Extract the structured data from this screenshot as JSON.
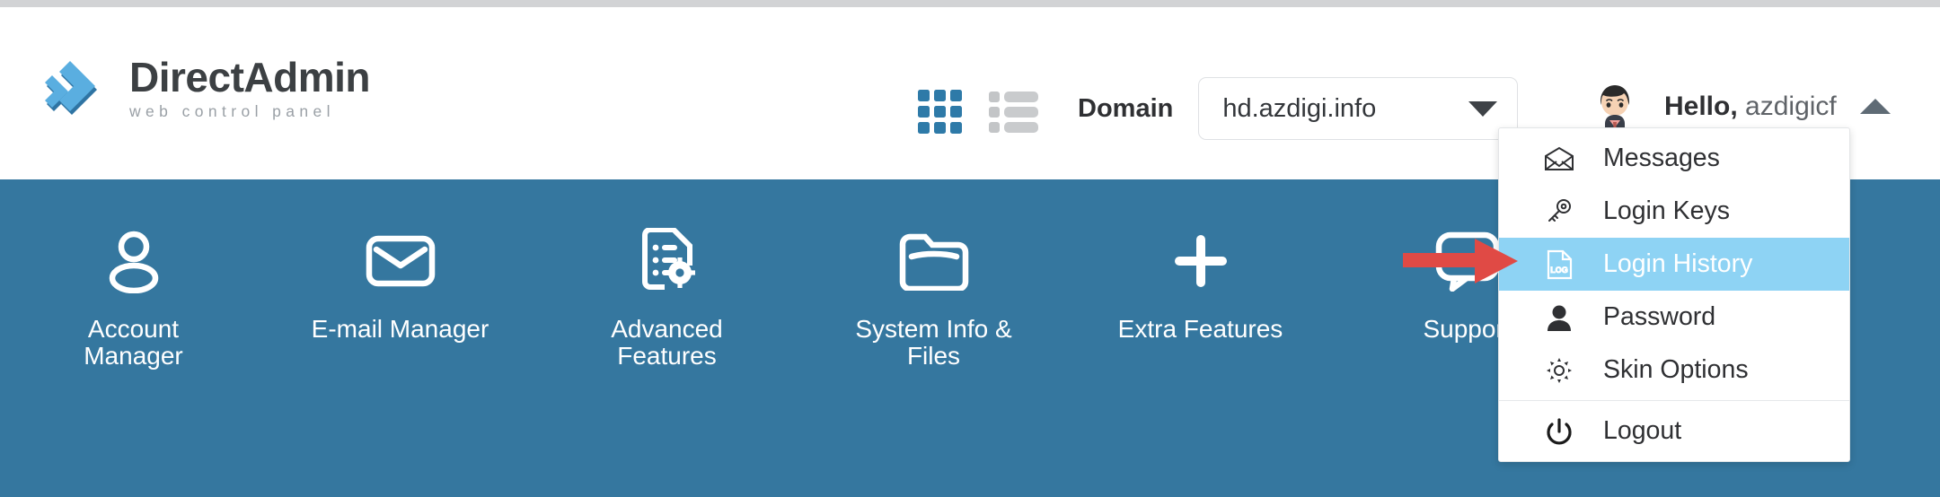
{
  "brand": {
    "name_part1": "Direct",
    "name_part2": "Admin",
    "tagline": "web control panel",
    "logo_icon": "double-chevron-logo",
    "logo_color": "#5aaee0",
    "logo_shadow_color": "#2f74a3"
  },
  "header": {
    "view_grid_icon": "grid-view-icon",
    "view_list_icon": "list-view-icon",
    "grid_active_color": "#2e7aa8",
    "list_inactive_color": "#c6c8ca",
    "domain_label": "Domain",
    "domain_value": "hd.azdigi.info",
    "domain_caret_icon": "chevron-down-icon",
    "avatar_icon": "user-avatar",
    "greeting_prefix": "Hello,",
    "username": "azdigicf",
    "user_caret_icon": "chevron-up-icon"
  },
  "navbar": {
    "background_color": "#35779f",
    "items": [
      {
        "label": "Account Manager",
        "icon": "person-icon"
      },
      {
        "label": "E-mail Manager",
        "icon": "envelope-icon"
      },
      {
        "label": "Advanced Features",
        "icon": "document-gear-icon"
      },
      {
        "label": "System Info & Files",
        "icon": "folder-icon"
      },
      {
        "label": "Extra Features",
        "icon": "plus-icon"
      },
      {
        "label": "Support",
        "icon": "chat-bubble-icon"
      }
    ]
  },
  "user_menu": {
    "highlight_color": "#8ed3f4",
    "items": [
      {
        "label": "Messages",
        "icon": "envelope-open-icon",
        "active": false
      },
      {
        "label": "Login Keys",
        "icon": "key-icon",
        "active": false
      },
      {
        "label": "Login History",
        "icon": "log-document-icon",
        "active": true
      },
      {
        "label": "Password",
        "icon": "person-filled-icon",
        "active": false
      },
      {
        "label": "Skin Options",
        "icon": "gear-icon",
        "active": false
      },
      {
        "label": "Logout",
        "icon": "power-icon",
        "active": false
      }
    ]
  },
  "annotation": {
    "arrow_icon": "red-arrow-pointer",
    "arrow_color": "#e04a45",
    "points_at": "Login History"
  }
}
